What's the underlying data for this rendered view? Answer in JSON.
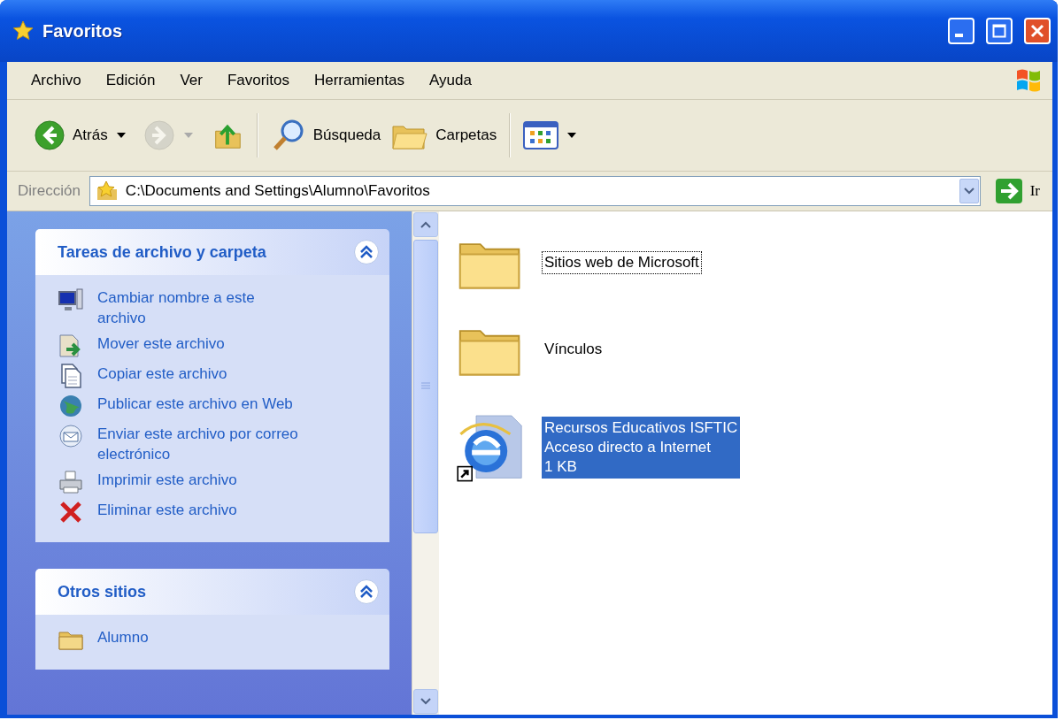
{
  "window": {
    "title": "Favoritos"
  },
  "menu": [
    {
      "label": "Archivo"
    },
    {
      "label": "Edición"
    },
    {
      "label": "Ver"
    },
    {
      "label": "Favoritos"
    },
    {
      "label": "Herramientas"
    },
    {
      "label": "Ayuda"
    }
  ],
  "toolbar": [
    {
      "kind": "back",
      "label": "Atrás",
      "disabled": false,
      "dropdown": true
    },
    {
      "kind": "forward",
      "disabled": true,
      "dropdown": true
    },
    {
      "kind": "up",
      "disabled": false
    },
    {
      "kind": "search",
      "label": "Búsqueda",
      "disabled": false
    },
    {
      "kind": "folders",
      "label": "Carpetas",
      "disabled": false
    },
    {
      "kind": "views",
      "disabled": false,
      "dropdown": true
    }
  ],
  "address": {
    "label": "Dirección",
    "value": "C:\\Documents and Settings\\Alumno\\Favoritos",
    "go_label": "Ir"
  },
  "task_panels": [
    {
      "title": "Tareas de archivo y carpeta",
      "expanded": true,
      "items": [
        {
          "kind": "rename",
          "label": "Cambiar nombre a este archivo"
        },
        {
          "kind": "move",
          "label": "Mover este archivo"
        },
        {
          "kind": "copy",
          "label": "Copiar este archivo"
        },
        {
          "kind": "publish",
          "label": "Publicar este archivo en Web"
        },
        {
          "kind": "email",
          "label": "Enviar este archivo por correo electrónico"
        },
        {
          "kind": "print",
          "label": "Imprimir este archivo"
        },
        {
          "kind": "delete",
          "label": "Eliminar este archivo"
        }
      ]
    },
    {
      "title": "Otros sitios",
      "expanded": true,
      "items": [
        {
          "kind": "folder",
          "label": "Alumno"
        }
      ]
    }
  ],
  "files": [
    {
      "kind": "folder",
      "name": "Sitios web de Microsoft",
      "selected": false,
      "focused": true
    },
    {
      "kind": "folder",
      "name": "Vínculos",
      "selected": false,
      "focused": false
    },
    {
      "kind": "shortcut",
      "name": "Recursos Educativos ISFTIC",
      "details": [
        "Acceso directo a Internet",
        "1 KB"
      ],
      "selected": true,
      "focused": false
    }
  ]
}
